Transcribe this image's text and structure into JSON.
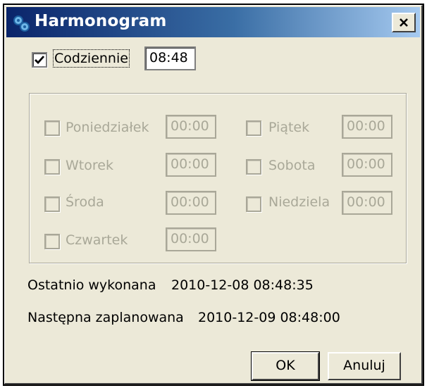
{
  "window": {
    "title": "Harmonogram",
    "close_label": "x"
  },
  "daily": {
    "label": "Codziennie",
    "checked": true,
    "time": "08:48"
  },
  "days": [
    {
      "label": "Poniedziałek",
      "time": "00:00"
    },
    {
      "label": "Wtorek",
      "time": "00:00"
    },
    {
      "label": "Środa",
      "time": "00:00"
    },
    {
      "label": "Czwartek",
      "time": "00:00"
    },
    {
      "label": "Piątek",
      "time": "00:00"
    },
    {
      "label": "Sobota",
      "time": "00:00"
    },
    {
      "label": "Niedziela",
      "time": "00:00"
    }
  ],
  "status": {
    "last_label": "Ostatnio wykonana",
    "last_value": "2010-12-08 08:48:35",
    "next_label": "Następna zaplanowana",
    "next_value": "2010-12-09 08:48:00"
  },
  "buttons": {
    "ok": "OK",
    "cancel": "Anuluj"
  }
}
